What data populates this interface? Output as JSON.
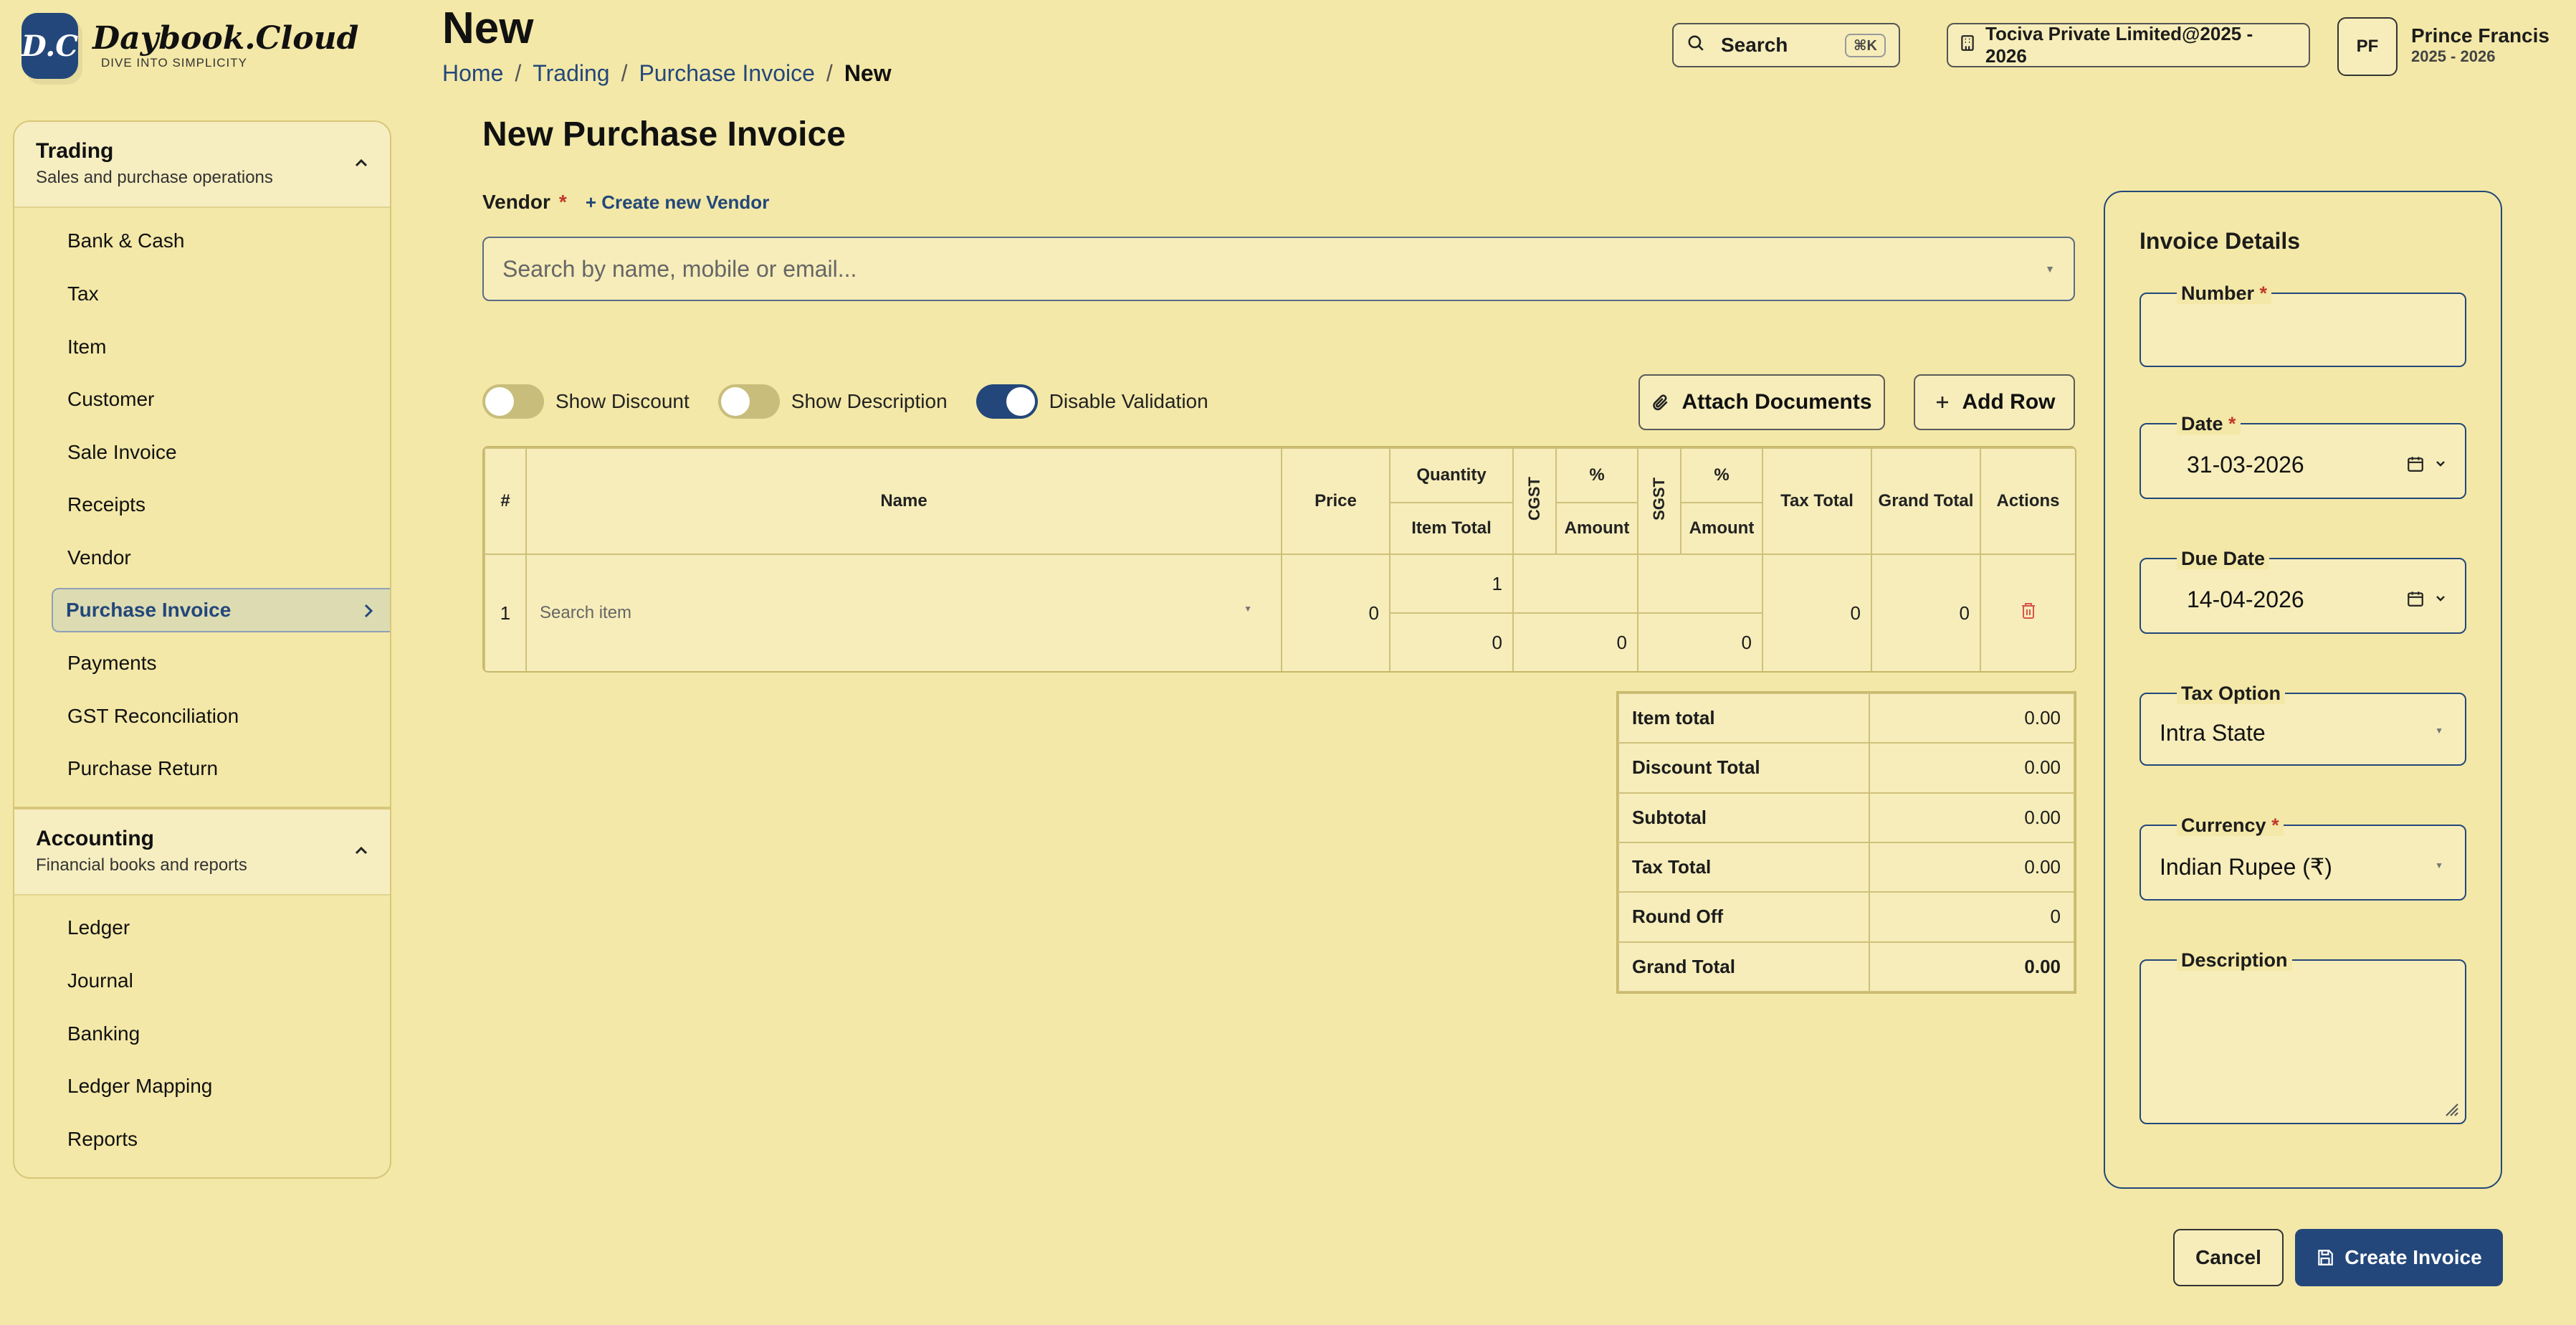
{
  "logo": {
    "badge": "D.C",
    "name": "Daybook.Cloud",
    "tagline": "DIVE INTO SIMPLICITY"
  },
  "header": {
    "title": "New",
    "breadcrumb": [
      "Home",
      "Trading",
      "Purchase Invoice",
      "New"
    ],
    "search_label": "Search",
    "search_shortcut": "⌘K",
    "company": "Tociva Private Limited@2025 - 2026",
    "user_initials": "PF",
    "user_name": "Prince Francis",
    "user_year": "2025 - 2026"
  },
  "sidebar": {
    "groups": [
      {
        "title": "Trading",
        "subtitle": "Sales and purchase operations",
        "items": [
          "Bank & Cash",
          "Tax",
          "Item",
          "Customer",
          "Sale Invoice",
          "Receipts",
          "Vendor",
          "Purchase Invoice",
          "Payments",
          "GST Reconciliation",
          "Purchase Return"
        ],
        "active": "Purchase Invoice"
      },
      {
        "title": "Accounting",
        "subtitle": "Financial books and reports",
        "items": [
          "Ledger",
          "Journal",
          "Banking",
          "Ledger Mapping",
          "Reports"
        ]
      }
    ]
  },
  "form": {
    "title": "New Purchase Invoice",
    "vendor_label": "Vendor",
    "required_mark": "*",
    "create_vendor": "+ Create new Vendor",
    "vendor_placeholder": "Search by name, mobile or email...",
    "toggles": [
      {
        "label": "Show Discount",
        "on": false
      },
      {
        "label": "Show Description",
        "on": false
      },
      {
        "label": "Disable Validation",
        "on": true
      }
    ],
    "attach_label": "Attach Documents",
    "add_row_label": "Add Row"
  },
  "items_table": {
    "headers": {
      "index": "#",
      "name": "Name",
      "price": "Price",
      "quantity": "Quantity",
      "item_total": "Item Total",
      "cgst": "CGST",
      "cgst_pct": "%",
      "cgst_amount": "Amount",
      "sgst": "SGST",
      "sgst_pct": "%",
      "sgst_amount": "Amount",
      "tax_total": "Tax Total",
      "grand_total": "Grand Total",
      "actions": "Actions"
    },
    "rows": [
      {
        "index": "1",
        "name_placeholder": "Search item",
        "price": "0",
        "quantity": "1",
        "item_total": "0",
        "cgst_pct": "",
        "cgst_amount": "0",
        "sgst_pct": "",
        "sgst_amount": "0",
        "tax_total": "0",
        "grand_total": "0"
      }
    ]
  },
  "totals": [
    {
      "label": "Item total",
      "value": "0.00"
    },
    {
      "label": "Discount Total",
      "value": "0.00"
    },
    {
      "label": "Subtotal",
      "value": "0.00"
    },
    {
      "label": "Tax Total",
      "value": "0.00"
    },
    {
      "label": "Round Off",
      "value": "0"
    },
    {
      "label": "Grand Total",
      "value": "0.00"
    }
  ],
  "details": {
    "title": "Invoice Details",
    "number_label": "Number",
    "number_value": "",
    "date_label": "Date",
    "date_value": "31-03-2026",
    "due_date_label": "Due Date",
    "due_date_value": "14-04-2026",
    "tax_option_label": "Tax Option",
    "tax_option_value": "Intra State",
    "currency_label": "Currency",
    "currency_value": "Indian Rupee (₹)",
    "description_label": "Description",
    "description_value": ""
  },
  "footer": {
    "cancel": "Cancel",
    "create": "Create Invoice"
  },
  "colors": {
    "background": "#f3e8a7",
    "primary": "#23477a",
    "danger": "#c0392b"
  }
}
